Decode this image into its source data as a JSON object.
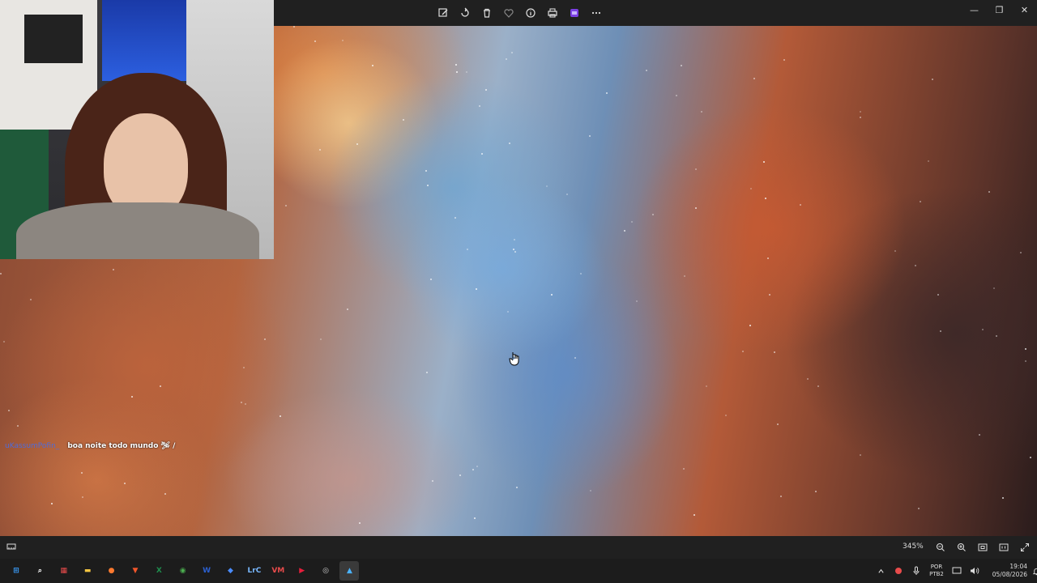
{
  "toolbar": {
    "buttons": [
      "edit-image",
      "rotate",
      "delete",
      "favorite",
      "file-info",
      "print",
      "clipchamp",
      "more"
    ]
  },
  "window_controls": {
    "minimize": "—",
    "maximize": "❐",
    "close": "✕"
  },
  "chat": {
    "username": "uKassumPofin_",
    "message": "boa noite todo mundo 🛩 /"
  },
  "viewer": {
    "zoom_level": "345%"
  },
  "taskbar": {
    "apps": [
      {
        "name": "windows-start",
        "glyph": "⊞",
        "color": "#3ba0ff"
      },
      {
        "name": "search",
        "glyph": "⌕",
        "color": "#ffffff"
      },
      {
        "name": "task-view",
        "glyph": "▦",
        "color": "#e84b4b"
      },
      {
        "name": "file-explorer",
        "glyph": "▬",
        "color": "#f5c542"
      },
      {
        "name": "firefox",
        "glyph": "●",
        "color": "#ff7a2f"
      },
      {
        "name": "brave",
        "glyph": "▼",
        "color": "#f1562b"
      },
      {
        "name": "excel",
        "glyph": "X",
        "color": "#1f8f4e"
      },
      {
        "name": "chrome",
        "glyph": "◉",
        "color": "#4caf50"
      },
      {
        "name": "word",
        "glyph": "W",
        "color": "#2b5fce"
      },
      {
        "name": "app-blue",
        "glyph": "◆",
        "color": "#4a8cff"
      },
      {
        "name": "lrc",
        "glyph": "LrC",
        "color": "#79b8ff"
      },
      {
        "name": "voice-meeter",
        "glyph": "VM",
        "color": "#e84b4b"
      },
      {
        "name": "media-player",
        "glyph": "▶",
        "color": "#e81e3c"
      },
      {
        "name": "obs",
        "glyph": "◎",
        "color": "#cccccc"
      },
      {
        "name": "photos",
        "glyph": "▲",
        "color": "#4ab3ff"
      }
    ],
    "language": "POR",
    "keyboard": "PTB2",
    "time": "19:04",
    "date": "05/08/2026"
  }
}
